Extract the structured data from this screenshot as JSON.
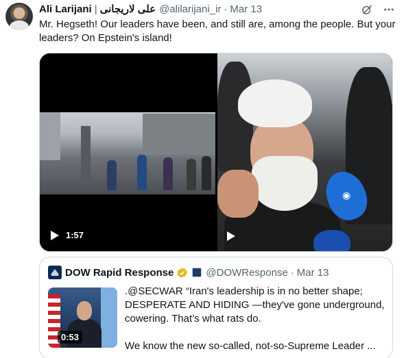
{
  "tweet": {
    "author_name": "Ali Larijani",
    "separator": "|",
    "author_name_rtl": "علی لاریجانی",
    "handle": "@alilarijani_ir",
    "dot": "·",
    "date": "Mar 13",
    "text": "Mr. Hegseth! Our leaders have been, and still are, among the people. But your leaders? On Epstein's island!",
    "icons": [
      "grok-icon",
      "more-icon"
    ]
  },
  "media": {
    "video_left": {
      "duration": "1:57",
      "icon": "play-icon"
    },
    "video_right": {
      "icon": "play-icon"
    }
  },
  "quote": {
    "name": "DOW Rapid Response",
    "verified": "gold-check-badge",
    "handle": "@DOWResponse",
    "dot": "·",
    "date": "Mar 13",
    "thumb_duration": "0:53",
    "lines": [
      ".@SECWAR “Iran's leadership is in no better shape;",
      "DESPERATE AND HIDING —they've gone underground,",
      "cowering. That’s what rats do.",
      "We know the new so-called, not-so-Supreme Leader ..."
    ]
  },
  "colors": {
    "text": "#0f1419",
    "secondary": "#536471",
    "border": "#cfd9de",
    "badge_gold": "#e2b719"
  }
}
